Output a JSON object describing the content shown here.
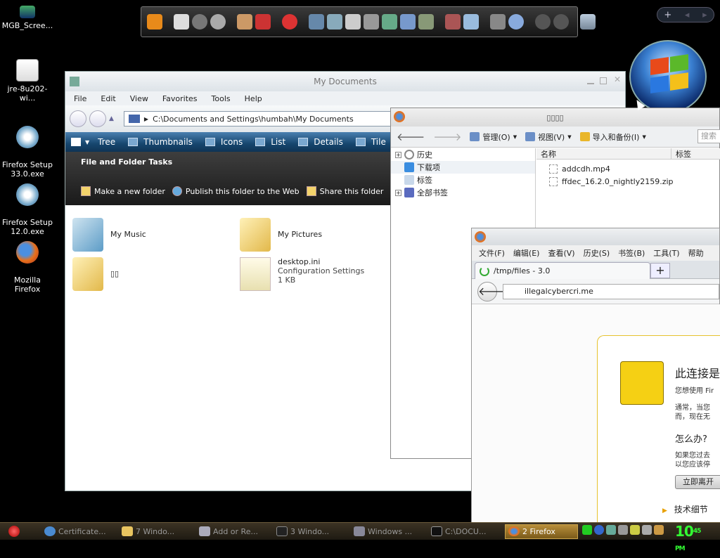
{
  "desktop": {
    "icons": [
      {
        "label": "MGB_Scree..."
      },
      {
        "label": "jre-8u202-wi..."
      },
      {
        "label": "Firefox Setup\n33.0.exe"
      },
      {
        "label": "Firefox Setup\n12.0.exe"
      },
      {
        "label": "Mozilla\nFirefox"
      }
    ]
  },
  "dock": {
    "pager": {
      "add": "+",
      "prev": "◂",
      "next": "▸"
    }
  },
  "explorer": {
    "title": "My Documents",
    "menu": [
      "File",
      "Edit",
      "View",
      "Favorites",
      "Tools",
      "Help"
    ],
    "address": "C:\\Documents and Settings\\humbah\\My Documents",
    "toolbar": [
      "Tree",
      "Thumbnails",
      "Icons",
      "List",
      "Details",
      "Tile"
    ],
    "tasks_header": "File and Folder Tasks",
    "tasks": [
      "Make a new folder",
      "Publish this folder to the Web",
      "Share this folder"
    ],
    "items": [
      {
        "name": "My Music"
      },
      {
        "name": "My Pictures"
      },
      {
        "name": "▯▯"
      },
      {
        "name": "desktop.ini",
        "type": "Configuration Settings",
        "size": "1 KB"
      }
    ]
  },
  "library": {
    "title": "▯▯▯▯",
    "toolbar": {
      "organize": "管理(O)",
      "views": "视图(V)",
      "import": "导入和备份(I)",
      "search_placeholder": "搜索"
    },
    "tree": [
      "历史",
      "下载项",
      "标签",
      "全部书签"
    ],
    "columns": [
      "名称",
      "标签"
    ],
    "files": [
      "addcdh.mp4",
      "ffdec_16.2.0_nightly2159.zip"
    ]
  },
  "firefox": {
    "menu": [
      "文件(F)",
      "编辑(E)",
      "查看(V)",
      "历史(S)",
      "书签(B)",
      "工具(T)",
      "帮助"
    ],
    "tab_title": "/tmp/files - 3.0",
    "newtab": "+",
    "url": "illegalcybercri.me",
    "error": {
      "title": "此连接是",
      "line1": "您想使用 Fir",
      "line2": "通常，当您",
      "line3": "而，现在无",
      "what_to_do": "怎么办?",
      "line4": "如果您过去",
      "line5": "以您应该停",
      "button": "立即离开",
      "tech": "技术细节"
    }
  },
  "taskbar": {
    "buttons": [
      {
        "label": "Certificate..."
      },
      {
        "label": "7 Windo..."
      },
      {
        "label": "Add or Re..."
      },
      {
        "label": "3 Windo..."
      },
      {
        "label": "Windows ..."
      },
      {
        "label": "C:\\DOCU..."
      },
      {
        "label": "2 Firefox"
      }
    ],
    "clock": {
      "time": "10",
      "minutes": "45",
      "ampm": "PM"
    }
  }
}
